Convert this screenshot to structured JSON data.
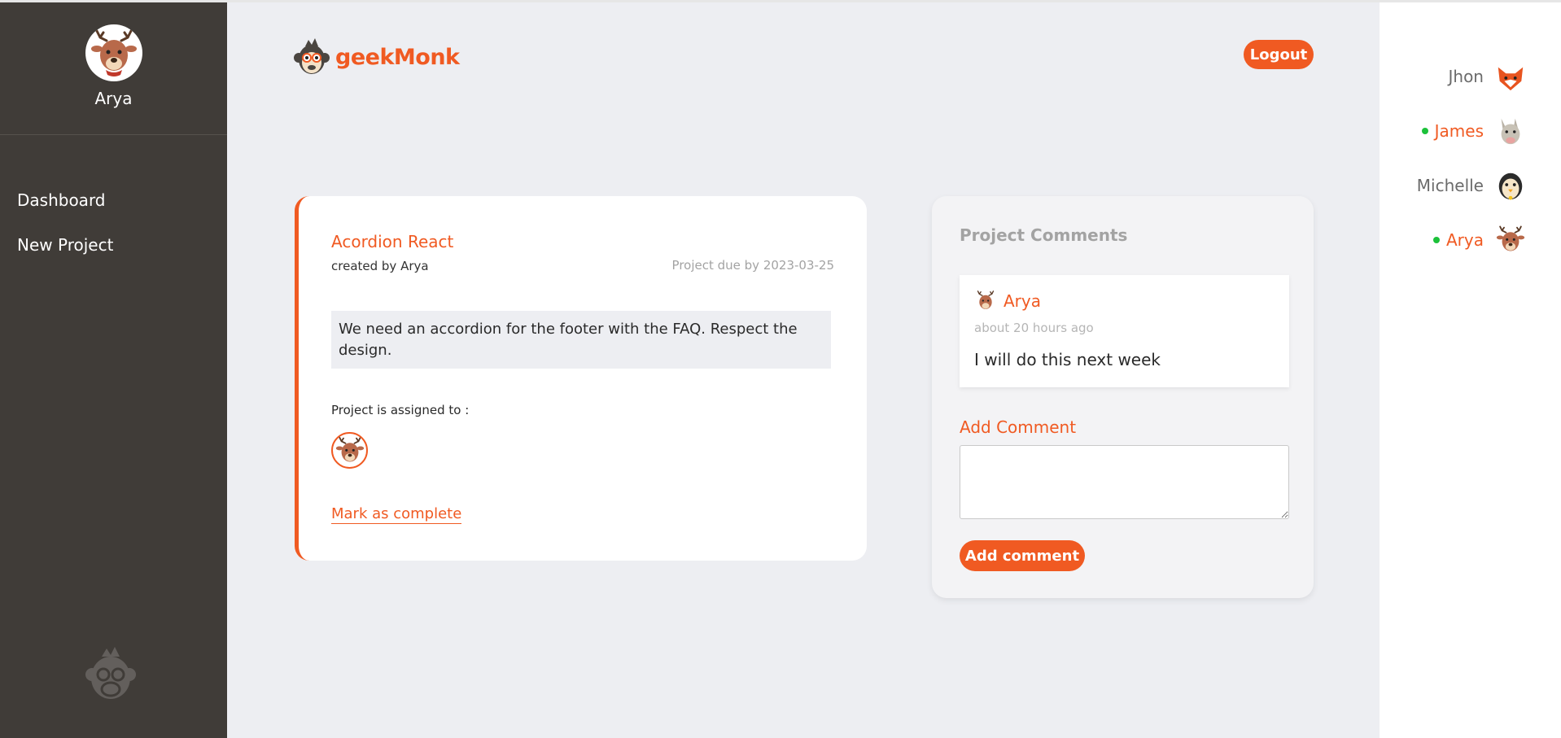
{
  "sidebar": {
    "user_name": "Arya",
    "nav": [
      {
        "label": "Dashboard"
      },
      {
        "label": "New Project"
      }
    ]
  },
  "header": {
    "brand": "geekMonk",
    "logout_label": "Logout"
  },
  "project": {
    "title": "Acordion React",
    "created_by": "created by Arya",
    "due": "Project due by 2023-03-25",
    "description": "We need an accordion for the footer with the FAQ. Respect the design.",
    "assigned_label": "Project is assigned to :",
    "complete_label": "Mark as complete"
  },
  "comments": {
    "title": "Project Comments",
    "items": [
      {
        "author": "Arya",
        "time": "about 20 hours ago",
        "text": "I will do this next week"
      }
    ],
    "add_label": "Add Comment",
    "add_button": "Add comment",
    "input_value": ""
  },
  "users": [
    {
      "name": "Jhon",
      "online": false,
      "avatar": "fox-icon"
    },
    {
      "name": "James",
      "online": true,
      "avatar": "dog-icon"
    },
    {
      "name": "Michelle",
      "online": false,
      "avatar": "penguin-icon"
    },
    {
      "name": "Arya",
      "online": true,
      "avatar": "deer-icon"
    }
  ],
  "colors": {
    "accent": "#f05a22",
    "sidebar_bg": "#403c38",
    "main_bg": "#edeef2",
    "online": "#1cc13a"
  }
}
